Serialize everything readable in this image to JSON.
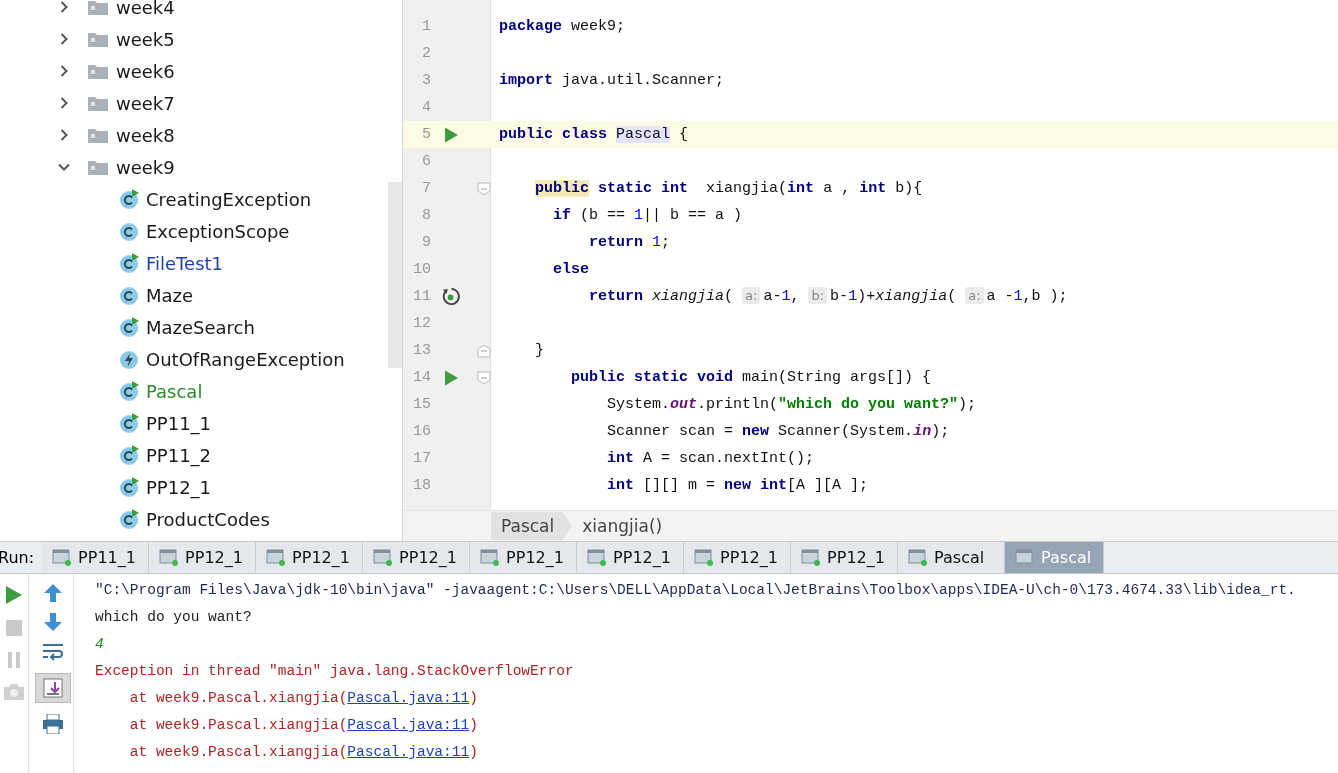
{
  "project_tree": {
    "items": [
      {
        "label": "week4",
        "expanded": false
      },
      {
        "label": "week5",
        "expanded": false
      },
      {
        "label": "week6",
        "expanded": false
      },
      {
        "label": "week7",
        "expanded": false
      },
      {
        "label": "week8",
        "expanded": false
      },
      {
        "label": "week9",
        "expanded": true,
        "children": [
          {
            "label": "CreatingException",
            "kind": "runnable",
            "modified": false,
            "added": false
          },
          {
            "label": "ExceptionScope",
            "kind": "class",
            "modified": false,
            "added": false
          },
          {
            "label": "FileTest1",
            "kind": "runnable",
            "modified": true,
            "added": false
          },
          {
            "label": "Maze",
            "kind": "class",
            "modified": false,
            "added": false
          },
          {
            "label": "MazeSearch",
            "kind": "runnable",
            "modified": false,
            "added": false
          },
          {
            "label": "OutOfRangeException",
            "kind": "exception",
            "modified": false,
            "added": false
          },
          {
            "label": "Pascal",
            "kind": "runnable",
            "modified": false,
            "added": true
          },
          {
            "label": "PP11_1",
            "kind": "runnable",
            "modified": false,
            "added": false
          },
          {
            "label": "PP11_2",
            "kind": "runnable",
            "modified": false,
            "added": false
          },
          {
            "label": "PP12_1",
            "kind": "runnable",
            "modified": false,
            "added": false
          },
          {
            "label": "ProductCodes",
            "kind": "runnable",
            "modified": false,
            "added": false
          }
        ]
      }
    ]
  },
  "editor": {
    "lines": [
      {
        "number": "1",
        "tokens": [
          {
            "kind": "keyword",
            "text": "package"
          },
          {
            "kind": "plain",
            "text": " week9;"
          }
        ]
      },
      {
        "number": "2"
      },
      {
        "number": "3",
        "tokens": [
          {
            "kind": "keyword",
            "text": "import"
          },
          {
            "kind": "plain",
            "text": " java.util.Scanner;"
          }
        ]
      },
      {
        "number": "4"
      },
      {
        "number": "5",
        "current": true,
        "run_marker": true,
        "tokens": [
          {
            "kind": "keyword",
            "text": "public class "
          },
          {
            "kind": "plain",
            "text": "Pascal",
            "highlight": true
          },
          {
            "kind": "plain",
            "text": " {"
          }
        ]
      },
      {
        "number": "6"
      },
      {
        "number": "7",
        "fold_start": true,
        "tokens": [
          {
            "kind": "keyword",
            "text": "    public",
            "highlight": true
          },
          {
            "kind": "keyword",
            "text": " static int"
          },
          {
            "kind": "plain",
            "text": "  xiangjia("
          },
          {
            "kind": "keyword",
            "text": "int"
          },
          {
            "kind": "plain",
            "text": " a , "
          },
          {
            "kind": "keyword",
            "text": "int"
          },
          {
            "kind": "plain",
            "text": " b){"
          }
        ]
      },
      {
        "number": "8",
        "tokens": [
          {
            "kind": "keyword",
            "text": "      if"
          },
          {
            "kind": "plain",
            "text": " (b == "
          },
          {
            "kind": "number",
            "text": "1"
          },
          {
            "kind": "plain",
            "text": "|| b == a )"
          }
        ]
      },
      {
        "number": "9",
        "tokens": [
          {
            "kind": "keyword",
            "text": "          return "
          },
          {
            "kind": "number",
            "text": "1"
          },
          {
            "kind": "plain",
            "text": ";"
          }
        ]
      },
      {
        "number": "10",
        "tokens": [
          {
            "kind": "keyword",
            "text": "      else"
          }
        ]
      },
      {
        "number": "11",
        "recursion_marker": true,
        "tokens": [
          {
            "kind": "keyword",
            "text": "          return "
          },
          {
            "kind": "italic",
            "text": "xiangjia"
          },
          {
            "kind": "plain",
            "text": "( "
          },
          {
            "kind": "hint",
            "text": "a:"
          },
          {
            "kind": "plain",
            "text": "a-"
          },
          {
            "kind": "number",
            "text": "1"
          },
          {
            "kind": "plain",
            "text": ", "
          },
          {
            "kind": "hint",
            "text": "b:"
          },
          {
            "kind": "plain",
            "text": "b-"
          },
          {
            "kind": "number",
            "text": "1"
          },
          {
            "kind": "plain",
            "text": ")+"
          },
          {
            "kind": "italic",
            "text": "xiangjia"
          },
          {
            "kind": "plain",
            "text": "( "
          },
          {
            "kind": "hint",
            "text": "a:"
          },
          {
            "kind": "plain",
            "text": "a -"
          },
          {
            "kind": "number",
            "text": "1"
          },
          {
            "kind": "plain",
            "text": ",b );"
          }
        ]
      },
      {
        "number": "12"
      },
      {
        "number": "13",
        "fold_end": true,
        "tokens": [
          {
            "kind": "plain",
            "text": "    }"
          }
        ]
      },
      {
        "number": "14",
        "run_marker": true,
        "fold_start": true,
        "tokens": [
          {
            "kind": "keyword",
            "text": "        public static void"
          },
          {
            "kind": "plain",
            "text": " main(String args[]) {"
          }
        ]
      },
      {
        "number": "15",
        "tokens": [
          {
            "kind": "plain",
            "text": "            System."
          },
          {
            "kind": "field",
            "text": "out"
          },
          {
            "kind": "plain",
            "text": ".println("
          },
          {
            "kind": "string",
            "text": "\"which do you want?\""
          },
          {
            "kind": "plain",
            "text": ");"
          }
        ]
      },
      {
        "number": "16",
        "tokens": [
          {
            "kind": "plain",
            "text": "            Scanner scan = "
          },
          {
            "kind": "keyword",
            "text": "new"
          },
          {
            "kind": "plain",
            "text": " Scanner(System."
          },
          {
            "kind": "field",
            "text": "in"
          },
          {
            "kind": "plain",
            "text": ");"
          }
        ]
      },
      {
        "number": "17",
        "tokens": [
          {
            "kind": "keyword",
            "text": "            int"
          },
          {
            "kind": "plain",
            "text": " A = scan.nextInt();"
          }
        ]
      },
      {
        "number": "18",
        "tokens": [
          {
            "kind": "keyword",
            "text": "            int"
          },
          {
            "kind": "plain",
            "text": " [][] m = "
          },
          {
            "kind": "keyword",
            "text": "new int"
          },
          {
            "kind": "plain",
            "text": "[A ][A ];"
          }
        ]
      }
    ],
    "breadcrumbs": [
      "Pascal",
      "xiangjia()"
    ]
  },
  "run": {
    "label": "Run:",
    "tabs": [
      {
        "label": "PP11_1",
        "selected": false
      },
      {
        "label": "PP12_1",
        "selected": false
      },
      {
        "label": "PP12_1",
        "selected": false
      },
      {
        "label": "PP12_1",
        "selected": false
      },
      {
        "label": "PP12_1",
        "selected": false
      },
      {
        "label": "PP12_1",
        "selected": false
      },
      {
        "label": "PP12_1",
        "selected": false
      },
      {
        "label": "PP12_1",
        "selected": false
      },
      {
        "label": "Pascal",
        "selected": false
      },
      {
        "label": "Pascal",
        "selected": true
      }
    ],
    "console": [
      {
        "kind": "command",
        "text": "\"C:\\Program Files\\Java\\jdk-10\\bin\\java\" -javaagent:C:\\Users\\DELL\\AppData\\Local\\JetBrains\\Toolbox\\apps\\IDEA-U\\ch-0\\173.4674.33\\lib\\idea_rt."
      },
      {
        "kind": "output",
        "text": "which do you want?"
      },
      {
        "kind": "input",
        "text": "4"
      },
      {
        "kind": "error",
        "text": "Exception in thread \"main\" java.lang.StackOverflowError"
      },
      {
        "kind": "trace",
        "text": "    at week9.Pascal.xiangjia(",
        "link": "Pascal.java:11",
        "end": ")"
      },
      {
        "kind": "trace",
        "text": "    at week9.Pascal.xiangjia(",
        "link": "Pascal.java:11",
        "end": ")"
      },
      {
        "kind": "trace",
        "text": "    at week9.Pascal.xiangjia(",
        "link": "Pascal.java:11",
        "end": ")"
      }
    ]
  }
}
